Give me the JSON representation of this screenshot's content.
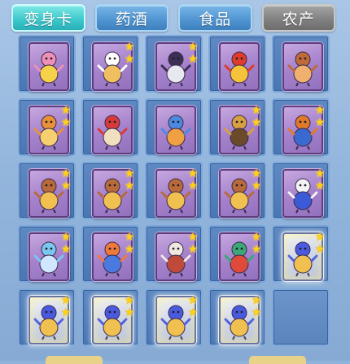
{
  "tabs": [
    {
      "label": "变身卡",
      "state": "active"
    },
    {
      "label": "药酒",
      "state": "normal"
    },
    {
      "label": "食品",
      "state": "normal"
    },
    {
      "label": "农产",
      "state": "disabled"
    }
  ],
  "colors": {
    "tab_active": "#3bc7cc",
    "tab_normal": "#4f93d0",
    "tab_disabled": "#7f7f7f",
    "star": "#ffd21a",
    "card_purple": "#a682cc",
    "card_silver": "#cfd6ea"
  },
  "items": [
    {
      "name": "pink-mask-creature",
      "stars": 0,
      "frame": "purple",
      "palette": [
        "#f08fb8",
        "#f6d14a"
      ]
    },
    {
      "name": "white-rabbit-fairy",
      "stars": 2,
      "frame": "purple",
      "palette": [
        "#ffffff",
        "#f0c060"
      ]
    },
    {
      "name": "dark-swordsman",
      "stars": 2,
      "frame": "purple",
      "palette": [
        "#3b2f55",
        "#e8e8f0"
      ]
    },
    {
      "name": "red-dragon-lion",
      "stars": 0,
      "frame": "purple",
      "palette": [
        "#e03b2a",
        "#f5c23a"
      ]
    },
    {
      "name": "brown-puppy",
      "stars": 0,
      "frame": "purple",
      "palette": [
        "#c06a3a",
        "#f0b070"
      ]
    },
    {
      "name": "orange-bear",
      "stars": 2,
      "frame": "purple",
      "palette": [
        "#e8913a",
        "#f6d070"
      ]
    },
    {
      "name": "red-monkey-warrior",
      "stars": 0,
      "frame": "purple",
      "palette": [
        "#d83a3a",
        "#f0e0c0"
      ]
    },
    {
      "name": "blue-bird-spirit",
      "stars": 0,
      "frame": "purple",
      "palette": [
        "#4a8ae0",
        "#f0a040"
      ]
    },
    {
      "name": "golden-armored-hero",
      "stars": 2,
      "frame": "purple",
      "palette": [
        "#d8a040",
        "#6a4a2a"
      ]
    },
    {
      "name": "orange-beast-rider",
      "stars": 2,
      "frame": "purple",
      "palette": [
        "#e07a2a",
        "#3a6ad0"
      ]
    },
    {
      "name": "wukong-warrior",
      "stars": 2,
      "frame": "purple",
      "palette": [
        "#b86a3a",
        "#f0c050"
      ]
    },
    {
      "name": "wukong-warrior",
      "stars": 2,
      "frame": "purple",
      "palette": [
        "#b86a3a",
        "#f0c050"
      ]
    },
    {
      "name": "wukong-warrior",
      "stars": 2,
      "frame": "purple",
      "palette": [
        "#b86a3a",
        "#f0c050"
      ]
    },
    {
      "name": "wukong-warrior",
      "stars": 2,
      "frame": "purple",
      "palette": [
        "#b86a3a",
        "#f0c050"
      ]
    },
    {
      "name": "white-haired-fighter",
      "stars": 2,
      "frame": "purple",
      "palette": [
        "#f4f4f4",
        "#3a5ad8"
      ]
    },
    {
      "name": "ice-dragon-spirit",
      "stars": 2,
      "frame": "purple",
      "palette": [
        "#7ac8f0",
        "#d0e8ff"
      ]
    },
    {
      "name": "fire-dancer",
      "stars": 2,
      "frame": "purple",
      "palette": [
        "#f07a3a",
        "#4a7ae0"
      ]
    },
    {
      "name": "white-dog-warrior",
      "stars": 2,
      "frame": "purple",
      "palette": [
        "#f0e8e0",
        "#c04a3a"
      ]
    },
    {
      "name": "jade-dragon",
      "stars": 2,
      "frame": "purple",
      "palette": [
        "#3aa878",
        "#e04a3a"
      ]
    },
    {
      "name": "blue-ninja",
      "stars": 2,
      "frame": "silver",
      "palette": [
        "#4a5ae0",
        "#f0c050"
      ]
    },
    {
      "name": "blue-ninja",
      "stars": 2,
      "frame": "silver",
      "palette": [
        "#4a5ae0",
        "#f0c050"
      ]
    },
    {
      "name": "blue-ninja",
      "stars": 2,
      "frame": "silver",
      "palette": [
        "#4a5ae0",
        "#f0c050"
      ]
    },
    {
      "name": "blue-ninja",
      "stars": 2,
      "frame": "silver",
      "palette": [
        "#4a5ae0",
        "#f0c050"
      ]
    },
    {
      "name": "blue-ninja",
      "stars": 2,
      "frame": "silver",
      "palette": [
        "#4a5ae0",
        "#f0c050"
      ]
    },
    {
      "name": "empty-slot",
      "stars": 0,
      "frame": "none",
      "palette": []
    }
  ]
}
